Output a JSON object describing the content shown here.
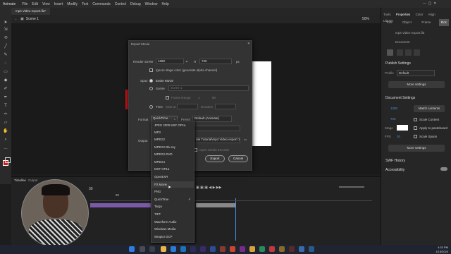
{
  "app": {
    "name": "Animate"
  },
  "menu": [
    "File",
    "Edit",
    "View",
    "Insert",
    "Modify",
    "Text",
    "Commands",
    "Control",
    "Debug",
    "Window",
    "Help"
  ],
  "document_tab": "mp4 Video export.fla*",
  "scene_label": "Scene 1",
  "zoom": "50%",
  "dialog": {
    "title": "Export Movie",
    "render_size_label": "Render size",
    "width_label": "W",
    "width_value": "1280",
    "height_label": "H",
    "height_value": "720",
    "unit": "px",
    "ignore_stage_color": "Ignore stage color (generate alpha channel)",
    "span_label": "Span",
    "entire_movie": "Entire Movie",
    "scene_option": "Scene",
    "scene_select": "Scene 1",
    "frame_range": "Frame Range",
    "frame_from": "1",
    "frame_to": "80",
    "time_option": "Time",
    "start_at": "Start at",
    "duration": "Duration",
    "format_label": "Format",
    "format_value": "QuickTime",
    "preset_label": "Preset",
    "preset_value": "Default (Animate)",
    "output_label": "Output",
    "output_path": "ate Tutorial\\mp4 Video export 1",
    "open_media_encoder": "Open Media Encoder",
    "export_button": "Export",
    "cancel_button": "Cancel"
  },
  "format_menu": {
    "items": [
      "JPEG 2000 MXF OP1a",
      "MP3",
      "MPEG2",
      "MPEG2 Blu-ray",
      "MPEG2-DVD",
      "MPEG4",
      "MXF OP1a",
      "OpenEXR",
      "P2 Movie",
      "PNG",
      "QuickTime",
      "Targa",
      "TIFF",
      "Waveform Audio",
      "Windows Media",
      "Wraptor DCP"
    ],
    "selected": "QuickTime",
    "hovered": "P2 Movie"
  },
  "right_panel": {
    "tabs": [
      "Tools",
      "Properties",
      "Color",
      "Align",
      "Library"
    ],
    "subtabs": [
      "Tool",
      "Object",
      "Frame",
      "Doc"
    ],
    "doc_name": "mp4 Video export.fla",
    "doc_type": "Document",
    "publish_settings": "Publish Settings",
    "profile_label": "Profile",
    "profile_value": "Default",
    "more_settings": "More settings",
    "document_settings": "Document Settings",
    "width": "1280",
    "height": "720",
    "match_contents": "Match contents",
    "scale_content": "Scale Content",
    "stage_label": "Stage",
    "apply_pasteboard": "Apply to pasteboard",
    "fps_label": "FPS",
    "fps_value": "30",
    "scale_spans": "Scale Spans",
    "more_settings2": "More settings",
    "swf_history": "SWF History",
    "accessibility": "Accessibility"
  },
  "timeline": {
    "tabs": [
      "Timeline",
      "Output"
    ],
    "fps_value": "30",
    "frame_marker": "90"
  },
  "clock": {
    "time": "4:32 PM",
    "date": "1/15/2024"
  },
  "colors": {
    "accent": "#4a90e2",
    "stage": "#ffffff",
    "red": "#d2171a"
  }
}
